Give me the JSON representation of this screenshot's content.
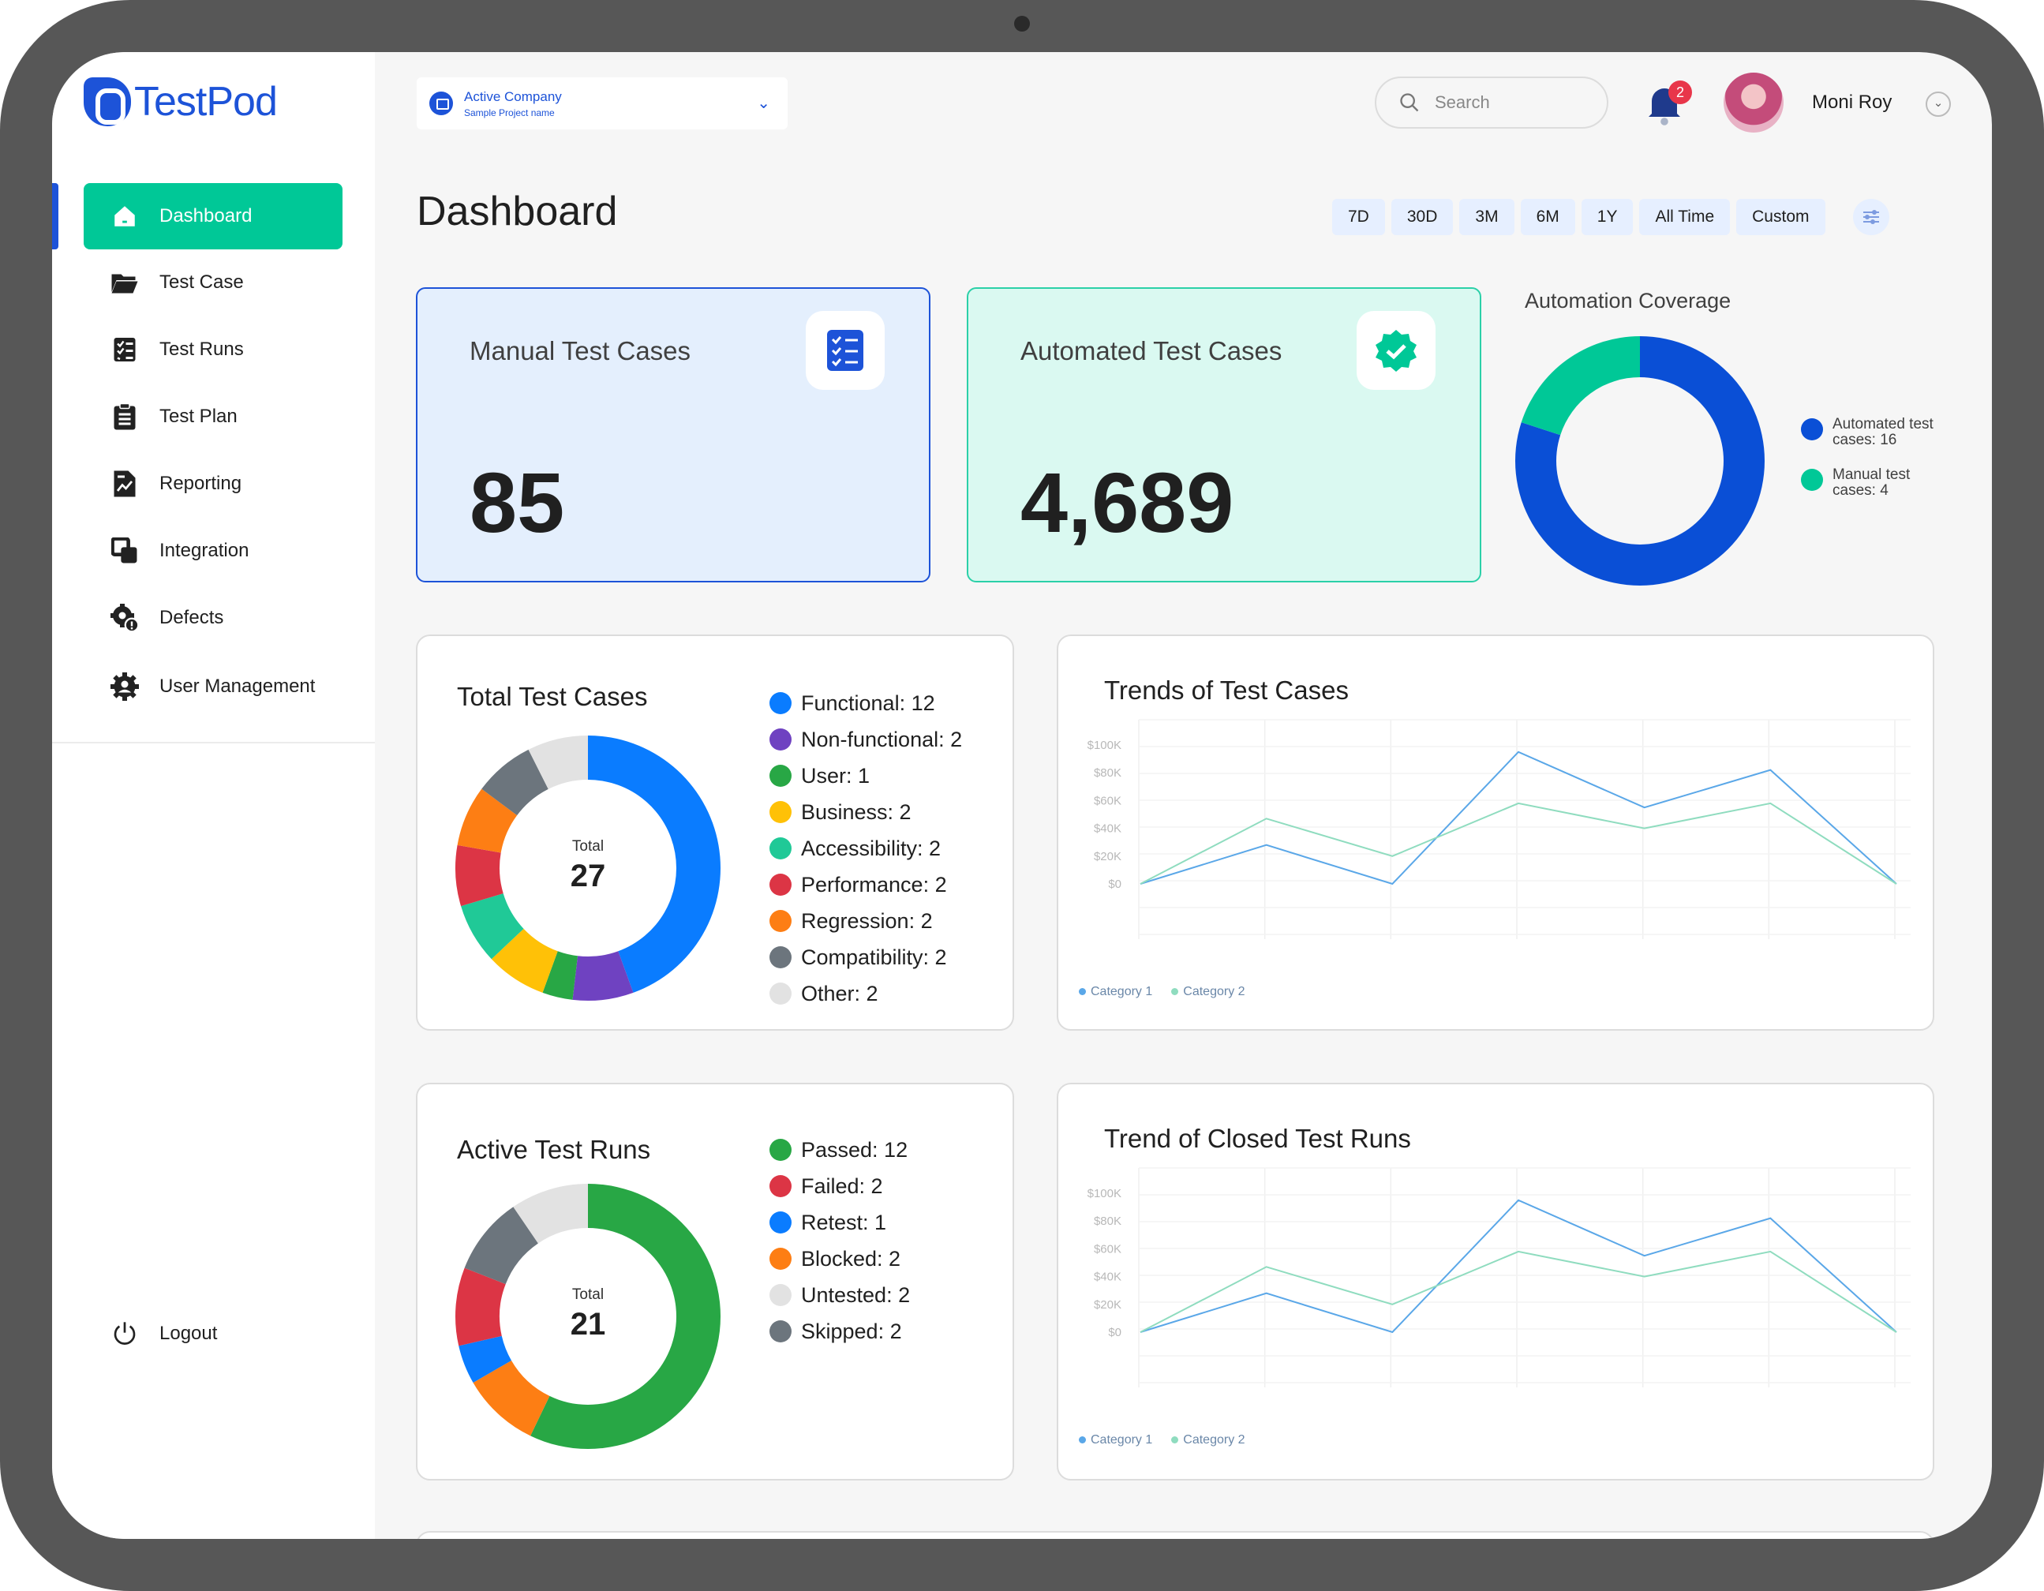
{
  "app": {
    "name": "TestPod"
  },
  "sidebar": {
    "items": [
      {
        "label": "Dashboard",
        "icon": "home-icon",
        "active": true
      },
      {
        "label": "Test Case",
        "icon": "folder-icon"
      },
      {
        "label": "Test Runs",
        "icon": "checklist-icon"
      },
      {
        "label": "Test Plan",
        "icon": "clipboard-icon"
      },
      {
        "label": "Reporting",
        "icon": "report-icon"
      },
      {
        "label": "Integration",
        "icon": "integration-icon"
      },
      {
        "label": "Defects",
        "icon": "defect-gear-icon"
      },
      {
        "label": "User Management",
        "icon": "user-gear-icon"
      }
    ],
    "logout": "Logout"
  },
  "header": {
    "company": {
      "title": "Active Company",
      "subtitle": "Sample Project name"
    },
    "search_placeholder": "Search",
    "notification_count": "2",
    "user_name": "Moni Roy"
  },
  "page": {
    "title": "Dashboard",
    "ranges": [
      "7D",
      "30D",
      "3M",
      "6M",
      "1Y",
      "All Time",
      "Custom"
    ]
  },
  "stats": {
    "manual": {
      "label": "Manual Test Cases",
      "value": "85"
    },
    "automated": {
      "label": "Automated Test Cases",
      "value": "4,689"
    }
  },
  "coverage": {
    "title": "Automation Coverage",
    "legend": [
      "Automated test cases: 16",
      "Manual test cases: 4"
    ]
  },
  "colors": {
    "brand": "#1d53d8",
    "accent": "#00c897"
  },
  "chart_data": [
    {
      "type": "pie",
      "title": "Automation Coverage",
      "categories": [
        "Automated test cases",
        "Manual test cases"
      ],
      "values": [
        16,
        4
      ],
      "colors": [
        "#0a4fd6",
        "#00c897"
      ]
    },
    {
      "type": "pie",
      "title": "Total Test Cases",
      "center_label": "Total",
      "center_value": "27",
      "categories": [
        "Functional",
        "Non-functional",
        "User",
        "Business",
        "Accessibility",
        "Performance",
        "Regression",
        "Compatibility",
        "Other"
      ],
      "values": [
        12,
        2,
        1,
        2,
        2,
        2,
        2,
        2,
        2
      ],
      "legend": [
        "Functional: 12",
        "Non-functional: 2",
        "User: 1",
        "Business: 2",
        "Accessibility: 2",
        "Performance: 2",
        "Regression: 2",
        "Compatibility: 2",
        "Other: 2"
      ],
      "colors": [
        "#0a7cff",
        "#6f42c1",
        "#28a745",
        "#ffc107",
        "#20c997",
        "#dc3545",
        "#fd7e14",
        "#6c757d",
        "#e2e2e2"
      ]
    },
    {
      "type": "pie",
      "title": "Active Test Runs",
      "center_label": "Total",
      "center_value": "21",
      "categories": [
        "Passed",
        "Failed",
        "Retest",
        "Blocked",
        "Untested",
        "Skipped"
      ],
      "values": [
        12,
        2,
        1,
        2,
        2,
        2
      ],
      "legend": [
        "Passed: 12",
        "Failed: 2",
        "Retest: 1",
        "Blocked: 2",
        "Untested: 2",
        "Skipped: 2"
      ],
      "colors": [
        "#28a745",
        "#dc3545",
        "#0a7cff",
        "#fd7e14",
        "#e2e2e2",
        "#6c757d"
      ],
      "draw_order": [
        0,
        3,
        2,
        1,
        5,
        4
      ]
    },
    {
      "type": "line",
      "title": "Trends of Test Cases",
      "y_ticks": [
        "$100K",
        "$80K",
        "$60K",
        "$40K",
        "$20K",
        "$0"
      ],
      "ylim": [
        0,
        100000
      ],
      "x": [
        0,
        1,
        2,
        3,
        4,
        5,
        6
      ],
      "series": [
        {
          "name": "Category 1",
          "values": [
            0,
            28000,
            0,
            95000,
            55000,
            82000,
            0
          ],
          "color": "#5aa7e8"
        },
        {
          "name": "Category 2",
          "values": [
            0,
            47000,
            20000,
            58000,
            40000,
            58000,
            0
          ],
          "color": "#8fdcbf"
        }
      ]
    },
    {
      "type": "line",
      "title": "Trend of Closed Test Runs",
      "y_ticks": [
        "$100K",
        "$80K",
        "$60K",
        "$40K",
        "$20K",
        "$0"
      ],
      "ylim": [
        0,
        100000
      ],
      "x": [
        0,
        1,
        2,
        3,
        4,
        5,
        6
      ],
      "series": [
        {
          "name": "Category 1",
          "values": [
            0,
            28000,
            0,
            95000,
            55000,
            82000,
            0
          ],
          "color": "#5aa7e8"
        },
        {
          "name": "Category 2",
          "values": [
            0,
            47000,
            20000,
            58000,
            40000,
            58000,
            0
          ],
          "color": "#8fdcbf"
        }
      ]
    }
  ]
}
